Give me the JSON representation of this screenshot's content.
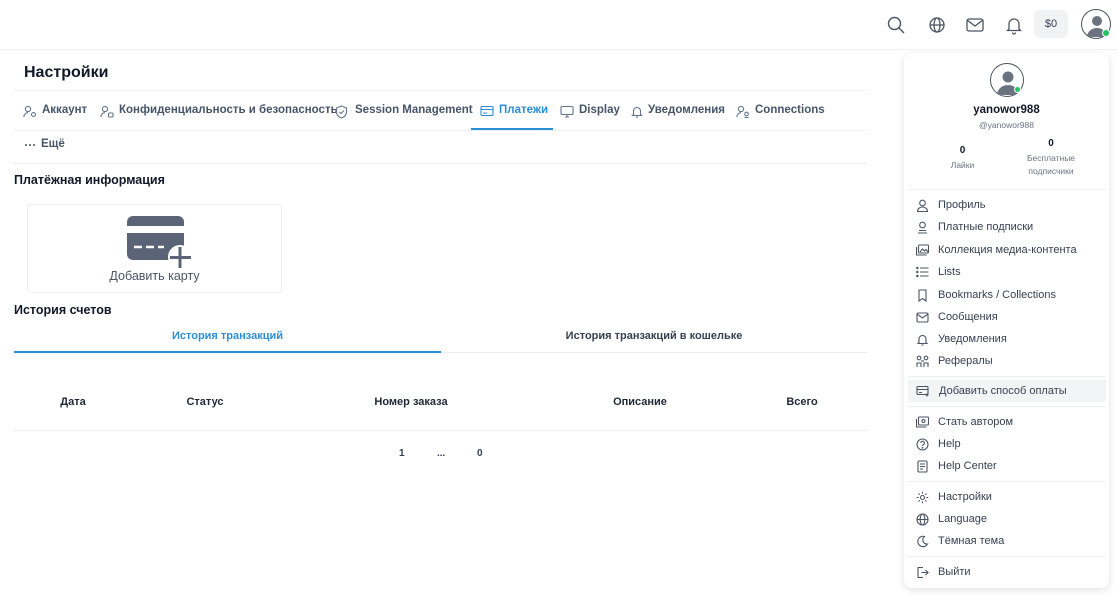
{
  "topbar": {
    "icons": [
      "search-icon",
      "globe-icon",
      "mail-icon",
      "bell-icon"
    ],
    "balance": "$0"
  },
  "page": {
    "title": "Настройки",
    "tabs": [
      {
        "label": "Аккаунт",
        "icon": "user-gear-icon"
      },
      {
        "label": "Конфиденциальность и безопасность",
        "icon": "user-lock-icon"
      },
      {
        "label": "Session Management",
        "icon": "shield-icon"
      },
      {
        "label": "Платежи",
        "icon": "payment-card-icon"
      },
      {
        "label": "Display",
        "icon": "monitor-icon"
      },
      {
        "label": "Уведомления",
        "icon": "bell-icon"
      },
      {
        "label": "Connections",
        "icon": "users-icon"
      },
      {
        "label": "Ещё",
        "icon": "dots-icon"
      }
    ],
    "active_tab": "Платежи"
  },
  "payment": {
    "title": "Платёжная информация",
    "add_card_label": "Добавить карту"
  },
  "history": {
    "title": "История счетов",
    "subtabs": [
      "История транзакций",
      "История транзакций в кошельке"
    ],
    "columns": [
      "Дата",
      "Статус",
      "Номер заказа",
      "Описание",
      "Всего"
    ],
    "pagination": [
      "1",
      "...",
      "0"
    ]
  },
  "dropdown": {
    "username": "yanowor988",
    "handle": "@yanowor988",
    "stats": [
      {
        "value": "0",
        "label": "Лайки"
      },
      {
        "value": "0",
        "label": "Бесплатные подписчики"
      }
    ],
    "items": [
      {
        "label": "Профиль",
        "icon": "user-icon"
      },
      {
        "label": "Платные подписки",
        "icon": "user-badge-icon"
      },
      {
        "label": "Коллекция медиа-контента",
        "icon": "media-icon"
      },
      {
        "label": "Lists",
        "icon": "list-icon"
      },
      {
        "label": "Bookmarks / Collections",
        "icon": "bookmark-icon"
      },
      {
        "label": "Сообщения",
        "icon": "mail-icon"
      },
      {
        "label": "Уведомления",
        "icon": "bell-icon"
      },
      {
        "label": "Рефералы",
        "icon": "referral-icon"
      },
      {
        "label": "Добавить способ оплаты",
        "icon": "card-add-icon"
      },
      {
        "label": "Стать автором",
        "icon": "creator-icon"
      },
      {
        "label": "Help",
        "icon": "help-icon"
      },
      {
        "label": "Help Center",
        "icon": "book-icon"
      },
      {
        "label": "Настройки",
        "icon": "gear-icon"
      },
      {
        "label": "Language",
        "icon": "globe-icon"
      },
      {
        "label": "Тёмная тема",
        "icon": "moon-icon"
      },
      {
        "label": "Выйти",
        "icon": "logout-icon"
      }
    ]
  },
  "colors": {
    "accent": "#2b8fd8",
    "online": "#22c55e",
    "card": "#5b6476"
  }
}
